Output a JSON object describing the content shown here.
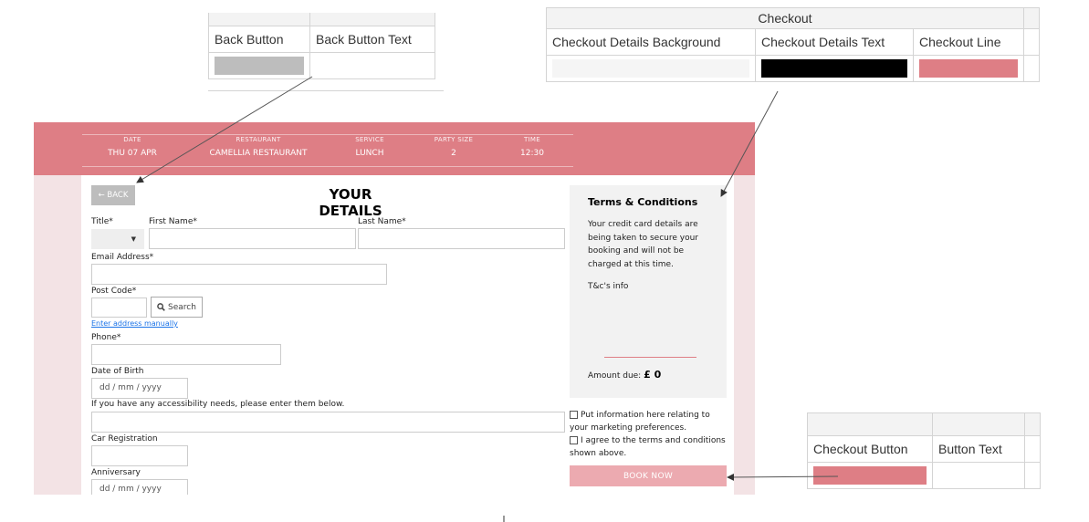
{
  "legend_back": {
    "headers": [
      "Back Button",
      "Back Button Text"
    ],
    "colors": {
      "back_button": "#bdbdbd",
      "back_button_text": "#ffffff"
    }
  },
  "legend_checkout": {
    "caption": "Checkout",
    "headers": [
      "Checkout Details Background",
      "Checkout Details Text",
      "Checkout Line"
    ],
    "colors": {
      "background": "#f2f2f2",
      "text": "#000000",
      "line": "#de7e85"
    }
  },
  "legend_button": {
    "headers": [
      "Checkout Button",
      "Button Text"
    ],
    "colors": {
      "button": "#de7e85",
      "text": "#ffffff"
    }
  },
  "summary": {
    "date": {
      "label": "DATE",
      "value": "THU 07 APR"
    },
    "restaurant": {
      "label": "RESTAURANT",
      "value": "CAMELLIA RESTAURANT"
    },
    "service": {
      "label": "SERVICE",
      "value": "LUNCH"
    },
    "party": {
      "label": "PARTY SIZE",
      "value": "2"
    },
    "time": {
      "label": "TIME",
      "value": "12:30"
    }
  },
  "form": {
    "back_label": "← BACK",
    "title": "YOUR DETAILS",
    "title_label": "Title*",
    "first_name_label": "First Name*",
    "last_name_label": "Last Name*",
    "email_label": "Email Address*",
    "postcode_label": "Post Code*",
    "search_label": "Search",
    "manual_link": "Enter address manually",
    "phone_label": "Phone*",
    "dob_label": "Date of Birth",
    "dob_value": "dd / mm / yyyy",
    "accessibility_label": "If you have any accessibility needs, please enter them below.",
    "car_label": "Car Registration",
    "anniversary_label": "Anniversary",
    "anniversary_value": "dd / mm / yyyy"
  },
  "terms": {
    "heading": "Terms & Conditions",
    "body": "Your credit card details are being taken to secure your booking and will not be charged at this time.",
    "info": "T&c's info",
    "amount_label": "Amount due:",
    "amount_value": "£ 0"
  },
  "checks": {
    "marketing": "Put information here relating to your marketing preferences.",
    "agree": "I agree to the terms and conditions shown above."
  },
  "book_label": "BOOK NOW",
  "colors": {
    "accent": "#de7e85",
    "frame_bg": "#f3e3e5",
    "book_button": "#ecaab0",
    "link": "#1a73e8"
  }
}
